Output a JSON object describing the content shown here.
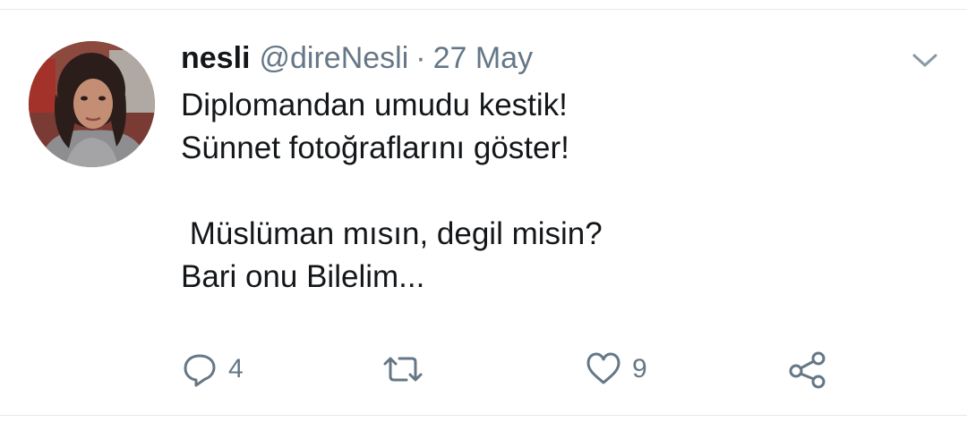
{
  "tweet": {
    "display_name": "nesli",
    "handle": "@direNesli",
    "separator": "·",
    "date": "27 May",
    "text": "Diplomandan umudu kestik!\nSünnet fotoğraflarını göster!\n\n Müslüman mısın, degil misin?\nBari onu Bilelim...",
    "avatar_icon": "profile-photo"
  },
  "actions": {
    "reply": {
      "icon": "reply-icon",
      "count": "4"
    },
    "retweet": {
      "icon": "retweet-icon",
      "count": ""
    },
    "like": {
      "icon": "heart-icon",
      "count": "9"
    },
    "share": {
      "icon": "share-icon"
    }
  },
  "menu": {
    "icon": "chevron-down-icon"
  },
  "colors": {
    "text": "#14171a",
    "muted": "#657786",
    "divider": "#e1e8ed"
  }
}
